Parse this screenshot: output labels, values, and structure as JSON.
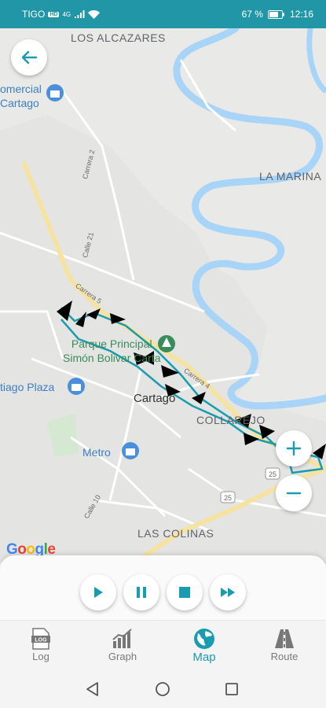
{
  "status_bar": {
    "carrier": "TIGO",
    "network_badge": "HD",
    "network_type": "4G",
    "battery": "67 %",
    "time": "12:16"
  },
  "map": {
    "labels": {
      "los_alcazares": "LOS ALCAZARES",
      "la_marina": "LA MARINA",
      "comercial_line1": "omercial",
      "comercial_line2": "Cartago",
      "parque_line1": "Parque Principal",
      "parque_line2": "Simón Bolivar Carta",
      "tiago_plaza": "tiago Plaza",
      "cartago": "Cartago",
      "collarejo": "COLLAREJO",
      "metro": "Metro",
      "las_colinas": "LAS COLINAS",
      "carrera_2": "Carrera 2",
      "calle_21": "Calle 21",
      "carrera_5": "Carrera 5",
      "carrera_4": "Carrera 4",
      "calle_10": "Calle 10",
      "route_25a": "25",
      "route_25b": "25"
    },
    "google_logo": "Google",
    "colors": {
      "river": "#a8d4f7",
      "track": "#1a9cb0",
      "accent": "#1a9cb0"
    }
  },
  "playback": {
    "play": "play-icon",
    "pause": "pause-icon",
    "stop": "stop-icon",
    "fast_forward": "fast-forward-icon"
  },
  "bottom_nav": {
    "items": [
      {
        "label": "Log",
        "icon": "log-icon",
        "active": false
      },
      {
        "label": "Graph",
        "icon": "graph-icon",
        "active": false
      },
      {
        "label": "Map",
        "icon": "globe-icon",
        "active": true
      },
      {
        "label": "Route",
        "icon": "road-icon",
        "active": false
      }
    ]
  }
}
